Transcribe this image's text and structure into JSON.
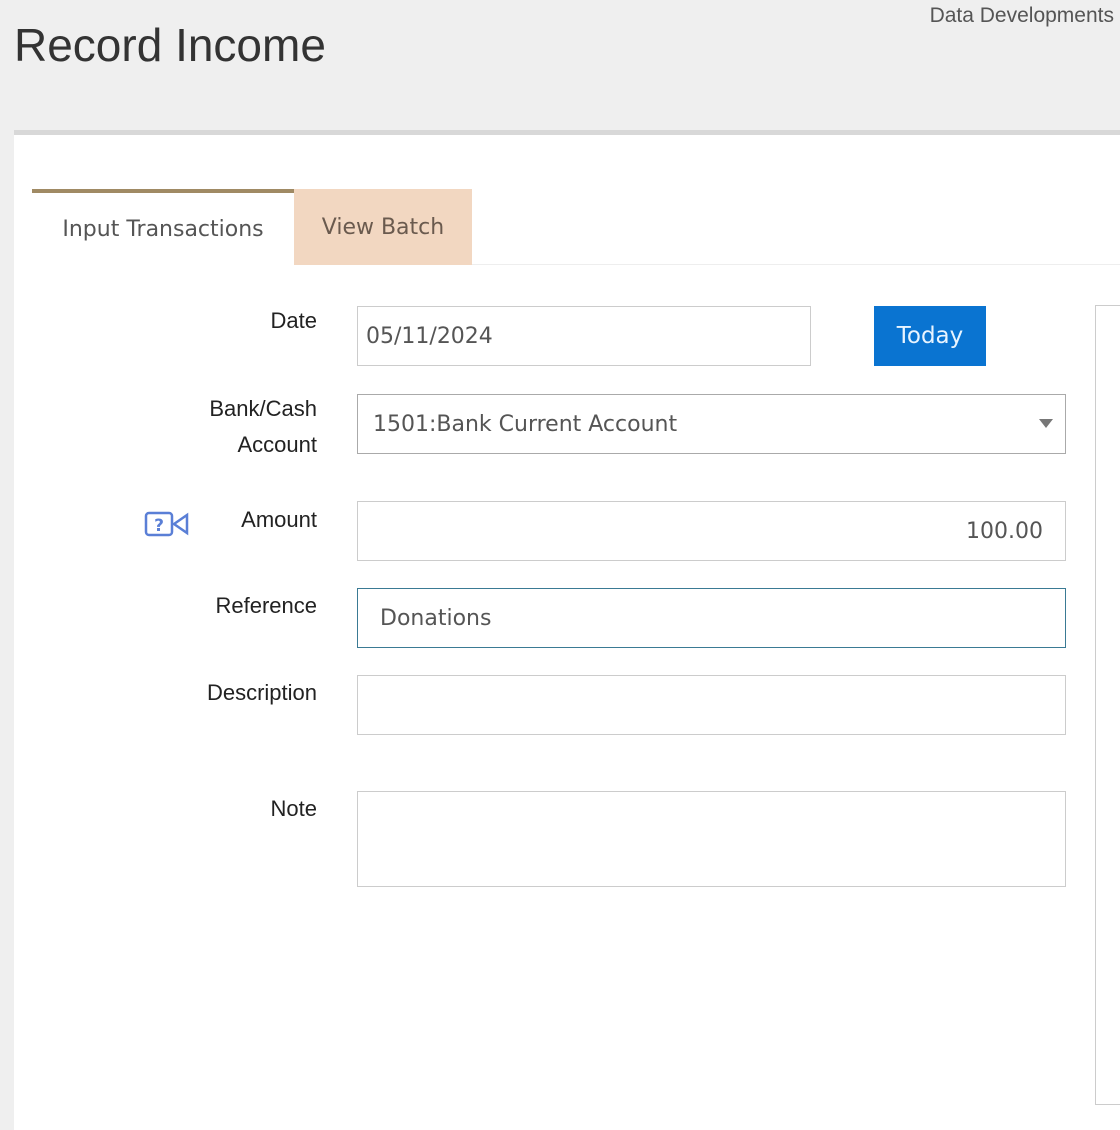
{
  "header": {
    "title": "Record Income",
    "organisation": "Data Developments"
  },
  "tabs": [
    {
      "label": "Input Transactions",
      "active": true
    },
    {
      "label": "View Batch",
      "active": false
    }
  ],
  "form": {
    "date": {
      "label": "Date",
      "value": "05/11/2024",
      "today_button": "Today"
    },
    "account": {
      "label_line1": "Bank/Cash",
      "label_line2": "Account",
      "value": "1501:Bank Current Account"
    },
    "amount": {
      "label": "Amount",
      "value": "100.00",
      "help_icon": "video-help-icon"
    },
    "reference": {
      "label": "Reference",
      "value": "Donations"
    },
    "description": {
      "label": "Description",
      "value": ""
    },
    "note": {
      "label": "Note",
      "value": ""
    }
  },
  "colors": {
    "accent": "#0a74d1",
    "tab_highlight": "#f2d7c1",
    "tab_border": "#a08a64"
  }
}
